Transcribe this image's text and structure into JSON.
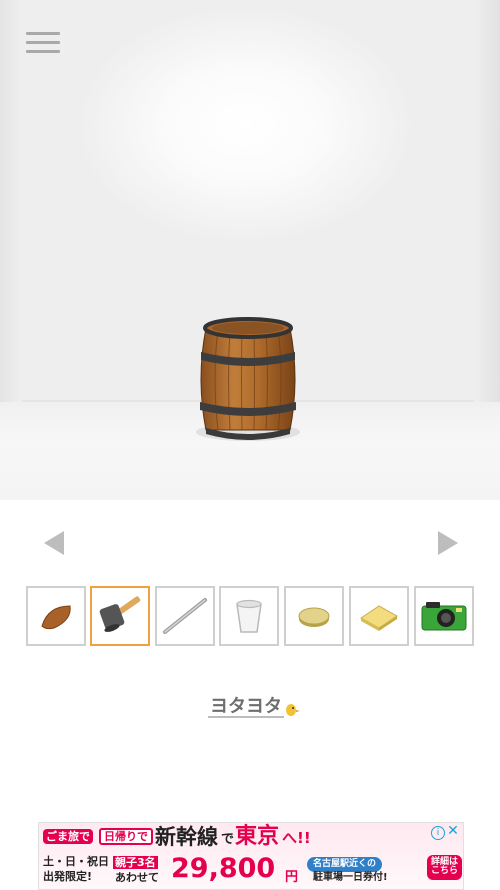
{
  "game": {
    "menu_icon": "hamburger-menu-icon",
    "scene_object": "barrel",
    "nav_left_icon": "triangle-left-icon",
    "nav_right_icon": "triangle-right-icon",
    "logo_text": "ヨタヨタ",
    "selected_slot": 1
  },
  "inventory": [
    {
      "icon": "seed-icon",
      "selected": false
    },
    {
      "icon": "mallet-icon",
      "selected": true
    },
    {
      "icon": "metal-rod-icon",
      "selected": false
    },
    {
      "icon": "paper-cup-icon",
      "selected": false
    },
    {
      "icon": "round-disc-icon",
      "selected": false
    },
    {
      "icon": "sponge-icon",
      "selected": false
    },
    {
      "icon": "green-camera-icon",
      "selected": false
    }
  ],
  "ad": {
    "tag1": "ごま旅で",
    "tag2": "日帰りで",
    "headline1": "新幹線",
    "headline_de": "で",
    "headline2": "東京",
    "headline3": "へ!!",
    "days_line1": "土・日・祝日",
    "days_line2": "出発限定!",
    "group_line1": "親子3名",
    "group_line2": "あわせて",
    "price": "29,800",
    "yen": "円",
    "station_line1": "名古屋駅近くの",
    "station_line2": "駐車場一日券付!",
    "detail_line1": "詳細は",
    "detail_line2": "こちら",
    "info_label": "i",
    "close_label": "✕",
    "accent_color": "#e5004f"
  }
}
